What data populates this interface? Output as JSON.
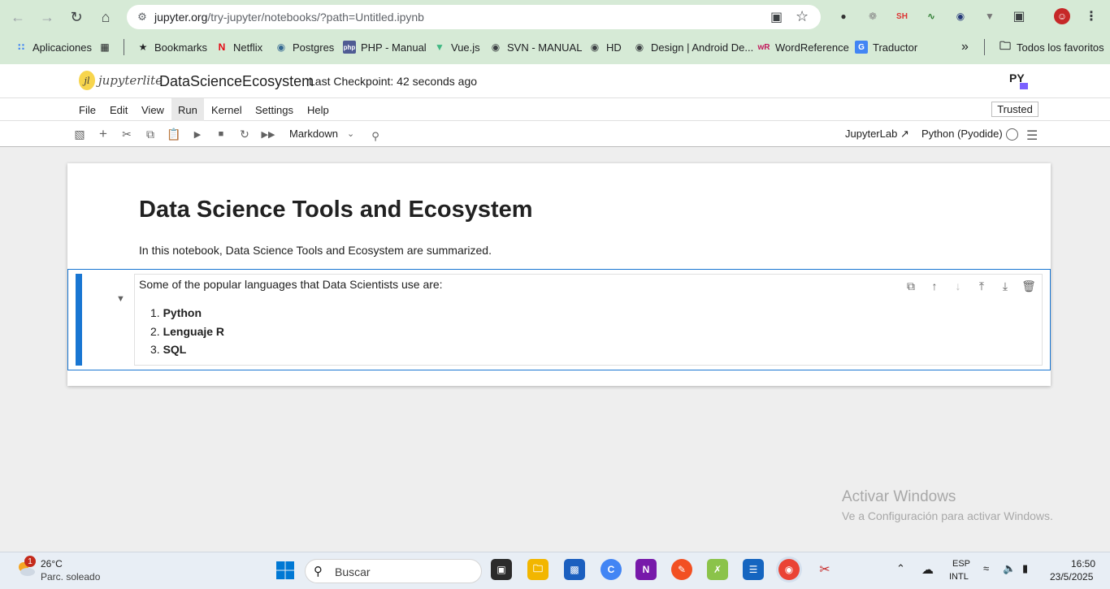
{
  "browser": {
    "url_host": "jupyter.org",
    "url_path": "/try-jupyter/notebooks/?path=Untitled.ipynb",
    "bookmarks": [
      {
        "label": "Aplicaciones",
        "icon": "apps-grid-icon"
      },
      {
        "label": "",
        "icon": "tab-groups-icon"
      },
      {
        "label": "Bookmarks",
        "icon": "star-icon"
      },
      {
        "label": "Netflix",
        "icon": "netflix-icon"
      },
      {
        "label": "Postgres",
        "icon": "postgres-icon"
      },
      {
        "label": "PHP - Manual",
        "icon": "php-icon"
      },
      {
        "label": "Vue.js",
        "icon": "vue-icon"
      },
      {
        "label": "SVN - MANUAL",
        "icon": "globe-icon"
      },
      {
        "label": "HD",
        "icon": "globe-icon"
      },
      {
        "label": "Design | Android De...",
        "icon": "globe-icon"
      },
      {
        "label": "WordReference",
        "icon": "wordreference-icon"
      },
      {
        "label": "Traductor",
        "icon": "translate-icon"
      }
    ],
    "overflow": "»",
    "all_bookmarks": "Todos los favoritos"
  },
  "jupyter": {
    "logo_text": "jupyterlite",
    "notebook_title": "DataScienceEcosystem",
    "checkpoint": "Last Checkpoint: 42 seconds ago",
    "menus": [
      "File",
      "Edit",
      "View",
      "Run",
      "Kernel",
      "Settings",
      "Help"
    ],
    "trusted": "Trusted",
    "cell_type": "Markdown",
    "jupyterlab_link": "JupyterLab",
    "kernel_name": "Python (Pyodide)"
  },
  "cells": {
    "heading": "Data Science Tools and Ecosystem",
    "intro": "In this notebook, Data Science Tools and Ecosystem are summarized.",
    "languages_intro": "Some of the popular languages that Data Scientists use are:",
    "languages": [
      {
        "num": "1.",
        "name": "Python"
      },
      {
        "num": "2.",
        "name": "Lenguaje R"
      },
      {
        "num": "3.",
        "name": "SQL"
      }
    ]
  },
  "watermark": {
    "line1": "Activar Windows",
    "line2": "Ve a Configuración para activar Windows."
  },
  "taskbar": {
    "badge": "1",
    "temperature": "26°C",
    "condition": "Parc. soleado",
    "search_placeholder": "Buscar",
    "lang_top": "ESP",
    "lang_bottom": "INTL",
    "time": "16:50",
    "date": "23/5/2025"
  }
}
